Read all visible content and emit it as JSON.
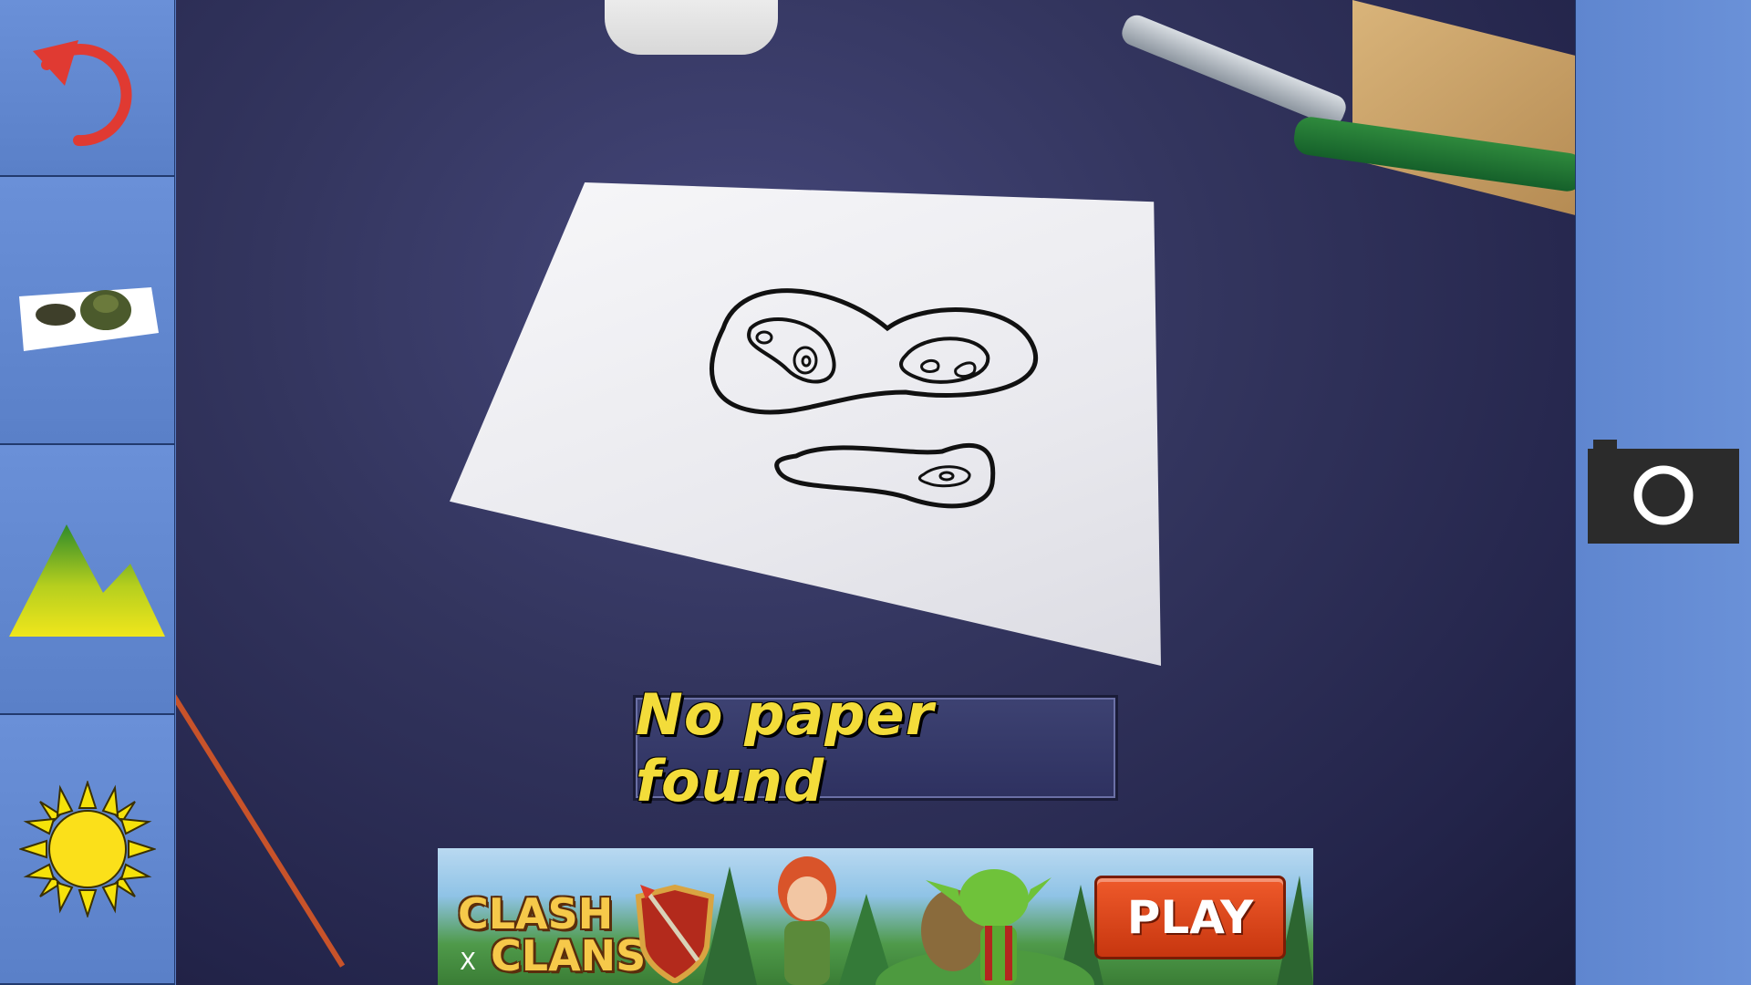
{
  "status": {
    "message": "No paper found"
  },
  "toolbar_left": {
    "buttons": [
      {
        "id": "undo",
        "icon": "undo-icon"
      },
      {
        "id": "terrain",
        "icon": "terrain-paper-icon"
      },
      {
        "id": "mountain",
        "icon": "mountain-icon"
      },
      {
        "id": "sun",
        "icon": "sun-icon"
      }
    ]
  },
  "toolbar_right": {
    "camera_icon": "camera-icon"
  },
  "ad": {
    "brand_line1": "CLASH",
    "brand_line2": "CLANS",
    "cta_label": "PLAY",
    "close_glyph": "X"
  },
  "colors": {
    "toolbar": "#5b7fc6",
    "status_text": "#f3dc3a",
    "status_bg": "#343868",
    "ad_button": "#e0491d"
  }
}
